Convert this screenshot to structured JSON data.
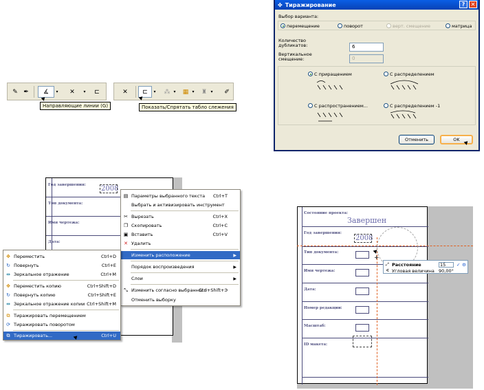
{
  "toolbar_left": {
    "tooltip": "Направляющие линии (G)"
  },
  "toolbar_right": {
    "tooltip": "Показать/Спрятать табло слежения"
  },
  "dialog": {
    "title": "Тиражирование",
    "help_label": "?",
    "close_label": "✕",
    "variant_label": "Выбор варианта:",
    "variants": [
      "перемещение",
      "поворот",
      "верт. смещение",
      "матрица"
    ],
    "count_label_1": "Количество",
    "count_label_2": "дубликатов:",
    "count_value": "6",
    "vshift_label_1": "Вертикальное",
    "vshift_label_2": "смещение:",
    "vshift_value": "0",
    "options": [
      "С приращением",
      "С распределением",
      "С распространением...",
      "С распределением -1"
    ],
    "cancel_label": "Отменить",
    "ok_label": "OK"
  },
  "stamp_left": {
    "year_label": "Год завершения:",
    "year_value": "2008",
    "doctype_label": "Тип документа:",
    "drawing_name_label": "Имя чертежа:",
    "date_label": "Дата:"
  },
  "context_menu": {
    "items": [
      {
        "icon": "text-params-icon",
        "glyph": "▤",
        "label": "Параметры выбранного текста",
        "shortcut": "Ctrl+T"
      },
      {
        "icon": "",
        "glyph": "",
        "label": "Выбрать и активизировать инструмент",
        "shortcut": ""
      },
      {
        "icon": "cut-icon",
        "glyph": "✂",
        "label": "Вырезать",
        "shortcut": "Ctrl+X"
      },
      {
        "icon": "copy-icon",
        "glyph": "❐",
        "label": "Скопировать",
        "shortcut": "Ctrl+C"
      },
      {
        "icon": "paste-icon",
        "glyph": "▣",
        "label": "Вставить",
        "shortcut": "Ctrl+V"
      },
      {
        "icon": "delete-icon",
        "glyph": "✕",
        "label": "Удалить",
        "shortcut": ""
      },
      {
        "icon": "",
        "glyph": "",
        "label": "Изменить расположение",
        "shortcut": ""
      },
      {
        "icon": "",
        "glyph": "",
        "label": "Порядок воспроизведения",
        "shortcut": ""
      },
      {
        "icon": "",
        "glyph": "",
        "label": "Слои",
        "shortcut": ""
      },
      {
        "icon": "resize-icon",
        "glyph": "⤡",
        "label": "Изменить согласно выбранного",
        "shortcut": "Ctrl+Shift+Э"
      },
      {
        "icon": "",
        "glyph": "",
        "label": "Отменить выборку",
        "shortcut": ""
      }
    ]
  },
  "submenu": {
    "items": [
      {
        "label": "Переместить",
        "shortcut": "Ctrl+D",
        "glyph": "✥"
      },
      {
        "label": "Повернуть",
        "shortcut": "Ctrl+E",
        "glyph": "↻"
      },
      {
        "label": "Зеркальное отражение",
        "shortcut": "Ctrl+M",
        "glyph": "⇹"
      },
      {
        "label": "Переместить копию",
        "shortcut": "Ctrl+Shift+D",
        "glyph": "✥"
      },
      {
        "label": "Повернуть копию",
        "shortcut": "Ctrl+Shift+E",
        "glyph": "↻"
      },
      {
        "label": "Зеркальное отражение копии",
        "shortcut": "Ctrl+Shift+M",
        "glyph": "⇹"
      },
      {
        "label": "Тиражировать перемещением",
        "shortcut": "",
        "glyph": "⧉"
      },
      {
        "label": "Тиражировать поворотом",
        "shortcut": "",
        "glyph": "⟳"
      },
      {
        "label": "Тиражировать...",
        "shortcut": "Ctrl+U",
        "glyph": "⧉"
      }
    ]
  },
  "stamp_right": {
    "status_label": "Состояние проекта:",
    "status_value": "Завершен",
    "year_label": "Год завершения:",
    "year_value": "2008",
    "doctype_label": "Тип документа:",
    "drawing_name_label": "Имя чертежа:",
    "date_label": "Дата:",
    "revision_label": "Номер редакции:",
    "scale_label": "Масштаб:",
    "sheet_id_label": "ID макета:"
  },
  "tracker": {
    "distance_label": "Расстояние",
    "distance_value": "15",
    "angle_label": "Угловая величина",
    "angle_value": "90,00°"
  },
  "colors": {
    "menu_highlight": "#316ac5",
    "title_bar": "#0a5ee6",
    "stamp_text": "#6a6aaa",
    "guide_line": "#e06020"
  }
}
